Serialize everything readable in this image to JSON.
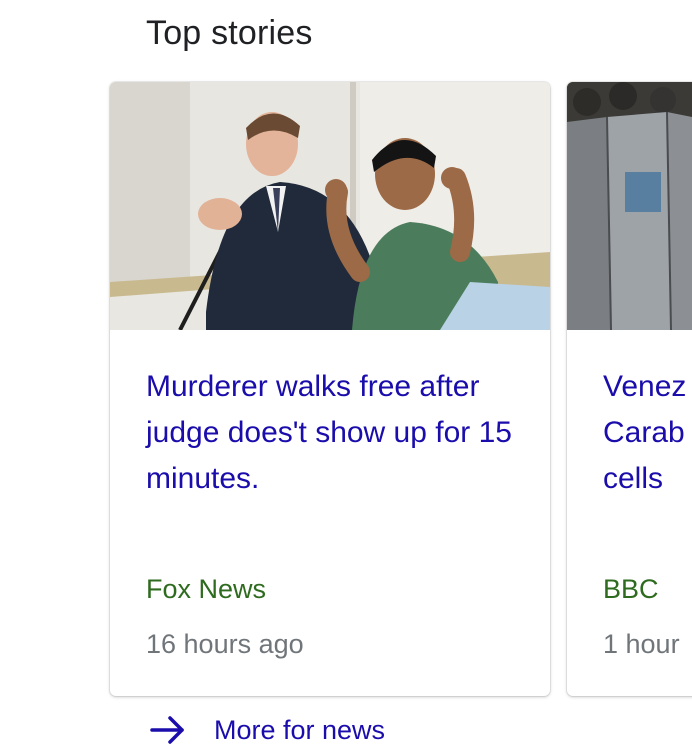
{
  "section": {
    "title": "Top stories"
  },
  "cards": [
    {
      "headline": "Murderer walks free after judge does't show up for 15 minutes.",
      "source": "Fox News",
      "time": "16 hours ago"
    },
    {
      "headline": "Venez\nCarab\ncells",
      "source": "BBC",
      "time": "1 hour"
    }
  ],
  "more": {
    "label": "More for news",
    "icon": "arrow-right-icon"
  },
  "colors": {
    "link": "#1a0dab",
    "source": "#2e6b1f",
    "muted": "#70757a",
    "title": "#202124"
  }
}
